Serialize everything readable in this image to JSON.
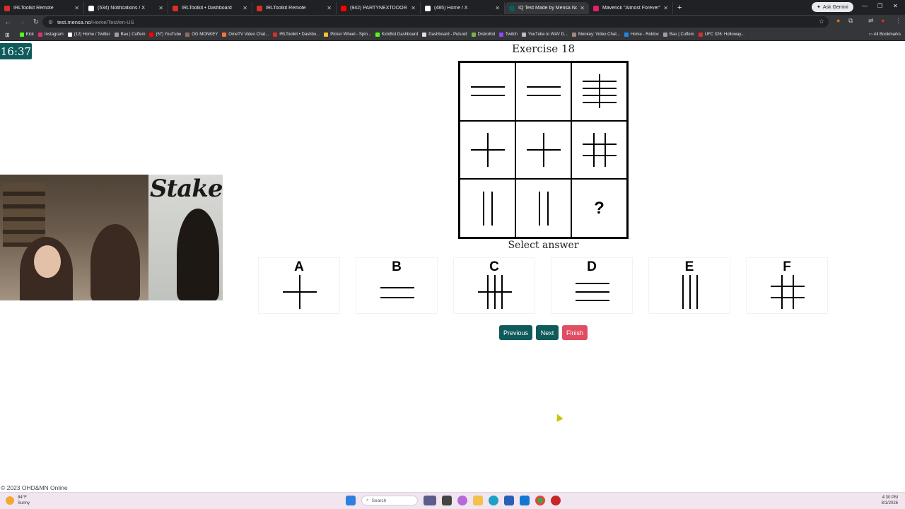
{
  "browser": {
    "tabs": [
      {
        "title": "IRLToolkit Remote",
        "color": "#d93025"
      },
      {
        "title": "(534) Notifications / X",
        "color": "#ffffff"
      },
      {
        "title": "IRLToolkit • Dashboard",
        "color": "#d93025"
      },
      {
        "title": "IRLToolkit Remote",
        "color": "#d93025"
      },
      {
        "title": "(942) PARTYNEXTDOOR - Only",
        "color": "#ff0000"
      },
      {
        "title": "(485) Home / X",
        "color": "#ffffff"
      },
      {
        "title": "IQ Test Made by Mensa Norwa",
        "color": "#0f5a5a"
      },
      {
        "title": "Maverick \"Almost Forever\" EP",
        "color": "#e91e63"
      }
    ],
    "active_tab_index": 6,
    "ask_gemini": "Ask Gemini",
    "url_host": "test.mensa.no",
    "url_path": "/Home/Test/en-US",
    "bookmarks": [
      {
        "label": "Kick",
        "color": "#53fc18"
      },
      {
        "label": "Instagram",
        "color": "#e1306c"
      },
      {
        "label": "(12) Home / Twitter",
        "color": "#ffffff"
      },
      {
        "label": "Bau | Cuffem",
        "color": "#9e9e9e"
      },
      {
        "label": "(57) YouTube",
        "color": "#ff0000"
      },
      {
        "label": "OG MONKEY",
        "color": "#8d6e63"
      },
      {
        "label": "OmeTV Video Chat...",
        "color": "#ff7043"
      },
      {
        "label": "IRLToolkit • Dashbo...",
        "color": "#d93025"
      },
      {
        "label": "Picker Wheel - Spin...",
        "color": "#fbc02d"
      },
      {
        "label": "KickBot Dashboard",
        "color": "#53fc18"
      },
      {
        "label": "Dashboard - Pulsoid",
        "color": "#e0e0e0"
      },
      {
        "label": "DistroKid",
        "color": "#7cb342"
      },
      {
        "label": "Twitch",
        "color": "#9146ff"
      },
      {
        "label": "YouTube to WAV D...",
        "color": "#bdbdbd"
      },
      {
        "label": "Monkey: Video Chat...",
        "color": "#a1887f"
      },
      {
        "label": "Home - Roblox",
        "color": "#1e88e5"
      },
      {
        "label": "Bau | Cuffem",
        "color": "#9e9e9e"
      },
      {
        "label": "UFC 326: Holloway...",
        "color": "#d32f2f"
      }
    ],
    "all_bookmarks": "All Bookmarks"
  },
  "page": {
    "timer": "16:37",
    "exercise_title": "Exercise 18",
    "matrix_question_mark": "?",
    "select_answer": "Select answer",
    "options": [
      {
        "letter": "A",
        "pattern": "plus"
      },
      {
        "letter": "B",
        "pattern": "two-horizontal-lines"
      },
      {
        "letter": "C",
        "pattern": "three-vertical-one-horizontal"
      },
      {
        "letter": "D",
        "pattern": "three-horizontal-lines"
      },
      {
        "letter": "E",
        "pattern": "three-vertical-lines"
      },
      {
        "letter": "F",
        "pattern": "hash-grid"
      }
    ],
    "matrix_cells": [
      "two-horizontal-lines",
      "two-horizontal-lines",
      "hash-grid-horizontal",
      "plus",
      "plus",
      "hash-grid",
      "two-vertical-lines",
      "two-vertical-lines",
      "question"
    ],
    "buttons": {
      "previous": "Previous",
      "next": "Next",
      "finish": "Finish"
    },
    "footer": "© 2023 OHD&MN Online",
    "accent_color": "#0f5a5a",
    "finish_color": "#e04e63"
  },
  "webcam": {
    "overlay_text": "Stake"
  },
  "taskbar": {
    "weather_temp": "84°F",
    "weather_cond": "Sunny",
    "search_placeholder": "Search",
    "time": "4:30 PM",
    "date": "8/1/2026"
  }
}
